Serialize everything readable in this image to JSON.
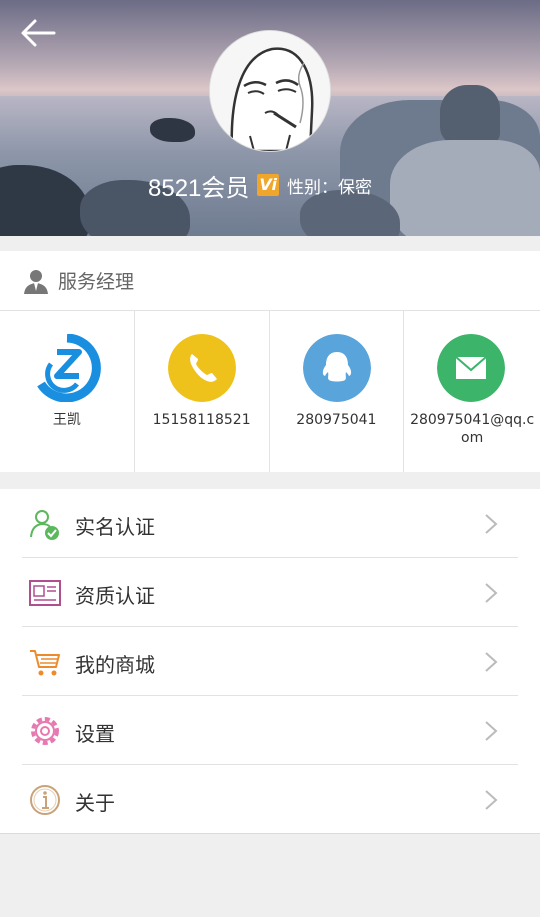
{
  "header": {
    "member_name": "8521会员",
    "vip_badge": "Vi",
    "gender_text": "性别：保密"
  },
  "service_manager": {
    "title": "服务经理",
    "contacts": [
      {
        "label": "王凯",
        "icon": "company-logo-icon",
        "color": "#1a8fe0"
      },
      {
        "label": "15158118521",
        "icon": "phone-icon",
        "color": "#eec21a"
      },
      {
        "label": "280975041",
        "icon": "qq-icon",
        "color": "#5aa4dc"
      },
      {
        "label": "280975041@qq.com",
        "icon": "mail-icon",
        "color": "#3cb56a"
      }
    ]
  },
  "menu": {
    "items": [
      {
        "label": "实名认证",
        "icon": "verified-user-icon",
        "color": "#5cb85c"
      },
      {
        "label": "资质认证",
        "icon": "certificate-icon",
        "color": "#b04e8e"
      },
      {
        "label": "我的商城",
        "icon": "shopping-cart-icon",
        "color": "#ef8a2c"
      },
      {
        "label": "设置",
        "icon": "settings-gear-icon",
        "color": "#e879b0"
      },
      {
        "label": "关于",
        "icon": "about-icon",
        "color": "#c9a27a"
      }
    ]
  }
}
